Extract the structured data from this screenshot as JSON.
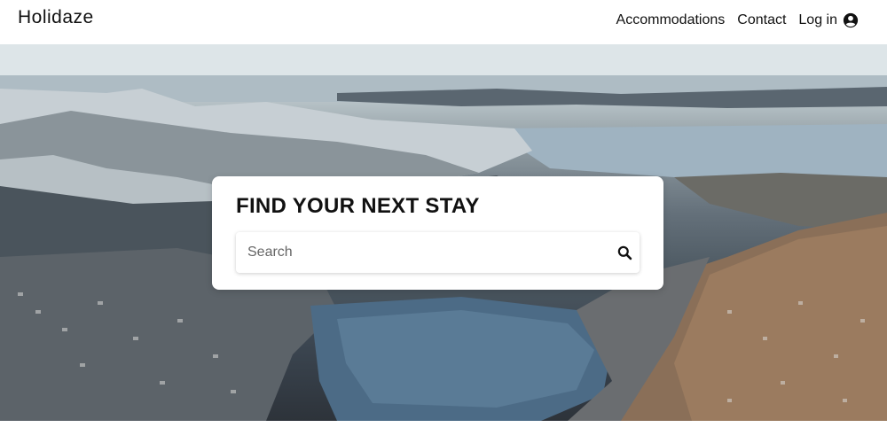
{
  "header": {
    "logo": "Holidaze",
    "nav": [
      {
        "label": "Accommodations"
      },
      {
        "label": "Contact"
      }
    ],
    "login_label": "Log in",
    "login_icon": "user-circle-icon"
  },
  "hero": {
    "image": "aerial-city-fjord-photo",
    "search": {
      "title": "FIND YOUR NEXT STAY",
      "placeholder": "Search",
      "value": "",
      "icon": "search-icon"
    }
  },
  "colors": {
    "text": "#111111",
    "card_bg": "#ffffff",
    "water": "#6f8ea6"
  }
}
